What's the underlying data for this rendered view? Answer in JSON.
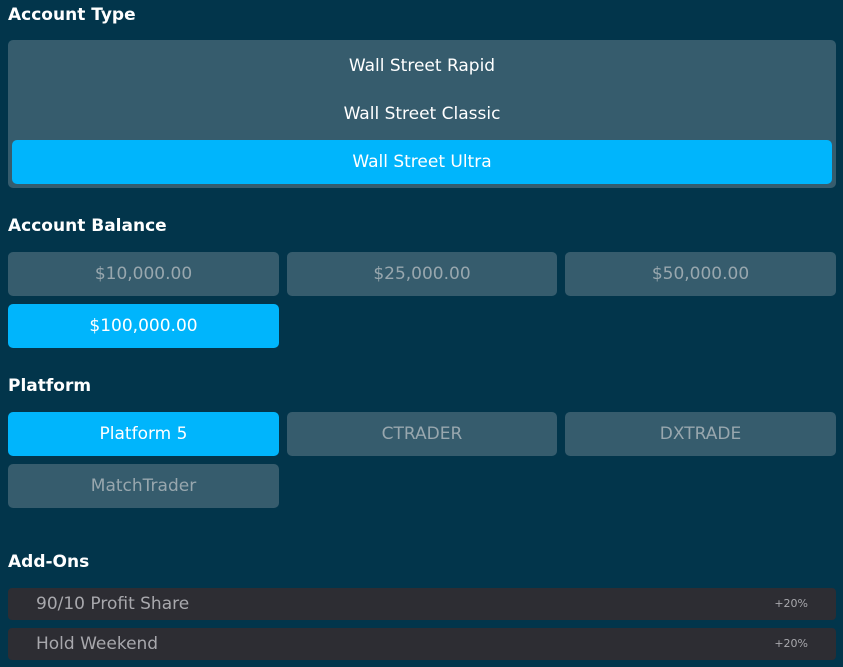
{
  "account_type": {
    "title": "Account Type",
    "options": [
      {
        "label": "Wall Street Rapid",
        "selected": false
      },
      {
        "label": "Wall Street Classic",
        "selected": false
      },
      {
        "label": "Wall Street Ultra",
        "selected": true
      }
    ]
  },
  "account_balance": {
    "title": "Account Balance",
    "options": [
      {
        "label": "$10,000.00",
        "selected": false
      },
      {
        "label": "$25,000.00",
        "selected": false
      },
      {
        "label": "$50,000.00",
        "selected": false
      },
      {
        "label": "$100,000.00",
        "selected": true
      }
    ]
  },
  "platform": {
    "title": "Platform",
    "options": [
      {
        "label": "Platform 5",
        "selected": true
      },
      {
        "label": "CTRADER",
        "selected": false
      },
      {
        "label": "DXTRADE",
        "selected": false
      },
      {
        "label": "MatchTrader",
        "selected": false
      }
    ]
  },
  "addons": {
    "title": "Add-Ons",
    "items": [
      {
        "label": "90/10 Profit Share",
        "price": "+20%"
      },
      {
        "label": "Hold Weekend",
        "price": "+20%"
      }
    ]
  },
  "colors": {
    "background": "#02354b",
    "panel": "#365c6d",
    "accent": "#00b5fc",
    "addon_bg": "#2d2d33"
  }
}
